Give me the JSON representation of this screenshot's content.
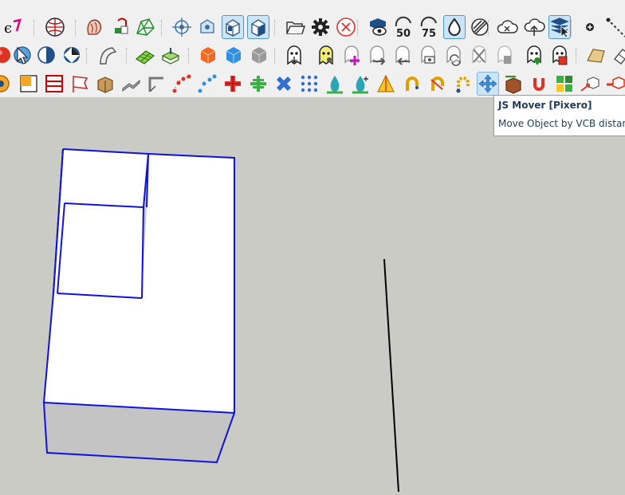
{
  "toolbar_rows": [
    {
      "row": 1,
      "tools": [
        {
          "name": "style-tool-icon",
          "label": "Style",
          "active": false
        },
        {
          "name": "globe-tool-icon",
          "label": "Geo-location",
          "active": false
        },
        {
          "name": "sandbox-smoove-icon",
          "label": "Smoove",
          "active": false
        },
        {
          "name": "sandbox-stamp-icon",
          "label": "Stamp",
          "active": false
        },
        {
          "name": "sandbox-mesh-icon",
          "label": "From Contours",
          "active": false
        },
        {
          "name": "position-camera-icon",
          "label": "Position Camera",
          "active": false
        },
        {
          "name": "look-around-icon",
          "label": "Look Around",
          "active": false
        },
        {
          "name": "front-view-icon",
          "label": "Front View",
          "active": true
        },
        {
          "name": "iso-view-icon",
          "label": "Iso View",
          "active": true
        },
        {
          "name": "open-folder-icon",
          "label": "Open",
          "active": false
        },
        {
          "name": "settings-gear-icon",
          "label": "Settings",
          "active": false
        },
        {
          "name": "cancel-icon",
          "label": "Cancel",
          "active": false
        },
        {
          "name": "view-toggle-icon",
          "label": "View",
          "active": false
        },
        {
          "name": "opacity-50-icon",
          "label": "50",
          "active": false
        },
        {
          "name": "opacity-75-icon",
          "label": "75",
          "active": false
        },
        {
          "name": "water-drop-icon",
          "label": "Drop",
          "active": true
        },
        {
          "name": "stripes-icon",
          "label": "Hatch",
          "active": false
        },
        {
          "name": "cloud-x-icon",
          "label": "Cloud Remove",
          "active": false
        },
        {
          "name": "cloud-up-icon",
          "label": "Cloud Upload",
          "active": false
        },
        {
          "name": "cursor-stack-icon",
          "label": "Cursor Stack",
          "active": true
        },
        {
          "name": "add-point-icon",
          "label": "Add Point",
          "active": false
        },
        {
          "name": "dashed-line-icon",
          "label": "Dashed Line",
          "active": false
        }
      ]
    },
    {
      "row": 2,
      "tools": [
        {
          "name": "red-sphere-icon",
          "label": "Sphere",
          "active": false
        },
        {
          "name": "cursor-orbit-icon",
          "label": "Orbit",
          "active": false
        },
        {
          "name": "half-circle-icon",
          "label": "Half",
          "active": false
        },
        {
          "name": "ball-icon",
          "label": "Ball",
          "active": false
        },
        {
          "name": "bend-icon",
          "label": "Bend",
          "active": false
        },
        {
          "name": "green-grid-icon",
          "label": "Grid",
          "active": false
        },
        {
          "name": "green-box-icon",
          "label": "Box",
          "active": false
        },
        {
          "name": "orange-cube-icon",
          "label": "Orange Cube",
          "active": false
        },
        {
          "name": "blue-cube-icon",
          "label": "Blue Cube",
          "active": false
        },
        {
          "name": "gray-cube-icon",
          "label": "Gray Cube",
          "active": false
        },
        {
          "name": "ghost-down-icon",
          "label": "Ghost Down",
          "active": false
        },
        {
          "name": "ghost-gear-icon",
          "label": "Ghost Gear",
          "active": false
        },
        {
          "name": "ghost-plus-icon",
          "label": "Ghost Plus",
          "active": false
        },
        {
          "name": "ghost-right-icon",
          "label": "Ghost Right",
          "active": false
        },
        {
          "name": "ghost-left-icon",
          "label": "Ghost Left",
          "active": false
        },
        {
          "name": "ghost-camera-icon",
          "label": "Ghost Camera",
          "active": false
        },
        {
          "name": "ghost-refresh-icon",
          "label": "Ghost Refresh",
          "active": false
        },
        {
          "name": "ghost-scissors-icon",
          "label": "Ghost Scissors",
          "active": false
        },
        {
          "name": "ghost-trash-icon",
          "label": "Ghost Trash",
          "active": false
        },
        {
          "name": "ghost-pin-icon",
          "label": "Ghost Pin",
          "active": false
        },
        {
          "name": "ghost-save-icon",
          "label": "Ghost Save",
          "active": false
        },
        {
          "name": "leaf-icon",
          "label": "Leaf",
          "active": false
        },
        {
          "name": "eraser-icon",
          "label": "Eraser",
          "active": false
        }
      ]
    },
    {
      "row": 3,
      "tools": [
        {
          "name": "arc-tool-icon",
          "label": "Arc",
          "active": false
        },
        {
          "name": "orange-square-icon",
          "label": "Square",
          "active": false
        },
        {
          "name": "red-lines-icon",
          "label": "Lines",
          "active": false
        },
        {
          "name": "flag-icon",
          "label": "Flag",
          "active": false
        },
        {
          "name": "wood-block-icon",
          "label": "Block",
          "active": false
        },
        {
          "name": "path-icon",
          "label": "Path",
          "active": false
        },
        {
          "name": "angle-icon",
          "label": "Angle",
          "active": false
        },
        {
          "name": "red-dots-line-icon",
          "label": "Dots Line",
          "active": false
        },
        {
          "name": "blue-dots-line-icon",
          "label": "Blue Dots",
          "active": false
        },
        {
          "name": "red-cross-icon",
          "label": "Cross",
          "active": false
        },
        {
          "name": "green-cross-icon",
          "label": "Green Cross",
          "active": false
        },
        {
          "name": "blue-x-icon",
          "label": "X",
          "active": false
        },
        {
          "name": "blue-grid-icon",
          "label": "Array",
          "active": false
        },
        {
          "name": "teal-drop-icon",
          "label": "Drop",
          "active": false
        },
        {
          "name": "teal-drop-plus-icon",
          "label": "Drop Plus",
          "active": false
        },
        {
          "name": "yellow-triangle-icon",
          "label": "Triangle",
          "active": false
        },
        {
          "name": "yellow-hook-icon",
          "label": "Hook",
          "active": false
        },
        {
          "name": "red-hook-icon",
          "label": "Red Hook",
          "active": false
        },
        {
          "name": "blue-hook-icon",
          "label": "Blue Hook",
          "active": false
        },
        {
          "name": "js-mover-icon",
          "label": "JS Mover",
          "active": false,
          "hover": true
        },
        {
          "name": "brown-box-icon",
          "label": "Brown Box",
          "active": false
        },
        {
          "name": "magnet-icon",
          "label": "Magnet",
          "active": false
        },
        {
          "name": "green-pieces-icon",
          "label": "Pieces",
          "active": false
        },
        {
          "name": "cube-arrow-icon",
          "label": "Cube Arrow",
          "active": false
        },
        {
          "name": "red-cube-arrow-icon",
          "label": "Red Cube Arrow",
          "active": false
        }
      ]
    }
  ],
  "tooltip": {
    "title": "JS Mover [Pixero]",
    "description": "Move Object by VCB distance"
  },
  "colors": {
    "canvas": "#cbcbc6",
    "toolbar_bg": "#f0f0f0",
    "selection_edge": "#1010e0",
    "face_top": "#ffffff",
    "face_side": "#c4c4c4",
    "active_bg": "#cce4f7",
    "active_border": "#4f94d4"
  }
}
